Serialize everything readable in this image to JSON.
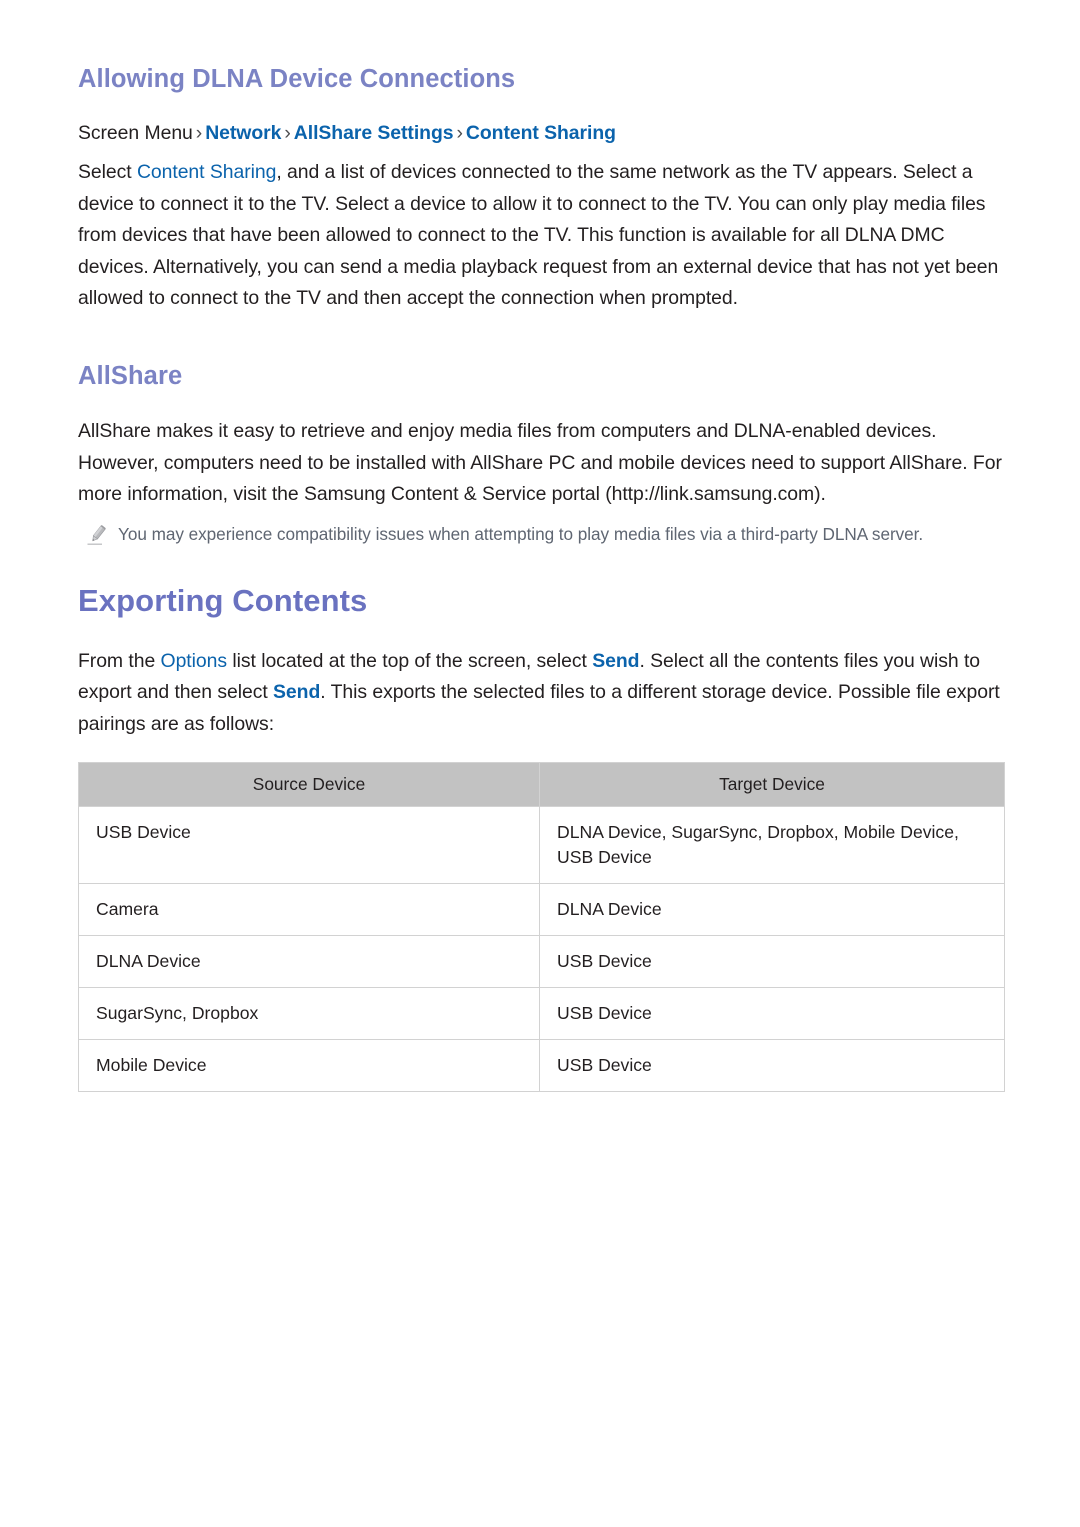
{
  "document": {
    "sections": [
      {
        "id": "allowing-dlna",
        "heading": "Allowing DLNA Device Connections",
        "breadcrumb": {
          "prefix": "Screen Menu",
          "separator": "›",
          "items": [
            "Network",
            "AllShare Settings",
            "Content Sharing"
          ]
        },
        "body_parts": {
          "p1_a": "Select ",
          "p1_link": "Content Sharing",
          "p1_b": ", and a list of devices connected to the same network as the TV appears. Select a device to connect it to the TV. Select a device to allow it to connect to the TV. You can only play media files from devices that have been allowed to connect to the TV. This function is available for all DLNA DMC devices. Alternatively, you can send a media playback request from an external device that has not yet been allowed to connect to the TV and then accept the connection when prompted."
        }
      },
      {
        "id": "allshare",
        "heading": "AllShare",
        "body": "AllShare makes it easy to retrieve and enjoy media files from computers and DLNA-enabled devices. However, computers need to be installed with AllShare PC and mobile devices need to support AllShare. For more information, visit the Samsung Content & Service portal (http://link.samsung.com).",
        "note": {
          "icon": "pencil-icon",
          "text": "You may experience compatibility issues when attempting to play media files via a third-party DLNA server."
        }
      },
      {
        "id": "exporting-contents",
        "heading": "Exporting Contents",
        "body_parts": {
          "a": "From the ",
          "link1": "Options",
          "b": " list located at the top of the screen, select ",
          "link2": "Send",
          "c": ". Select all the contents files you wish to export and then select ",
          "link3": "Send",
          "d": ". This exports the selected files to a different storage device. Possible file export pairings are as follows:"
        }
      }
    ]
  },
  "table": {
    "headers": [
      "Source Device",
      "Target Device"
    ],
    "rows": [
      [
        "USB Device",
        "DLNA Device, SugarSync, Dropbox, Mobile Device, USB Device"
      ],
      [
        "Camera",
        "DLNA Device"
      ],
      [
        "DLNA Device",
        "USB Device"
      ],
      [
        "SugarSync, Dropbox",
        "USB Device"
      ],
      [
        "Mobile Device",
        "USB Device"
      ]
    ]
  },
  "colors": {
    "heading_purple": "#7b83c4",
    "title_purple": "#6a72c0",
    "link_blue": "#0b63ac",
    "body_text": "#231f20",
    "note_text": "#5f6672",
    "table_header_bg": "#c2c2c2",
    "table_border": "#d2d2d2"
  }
}
